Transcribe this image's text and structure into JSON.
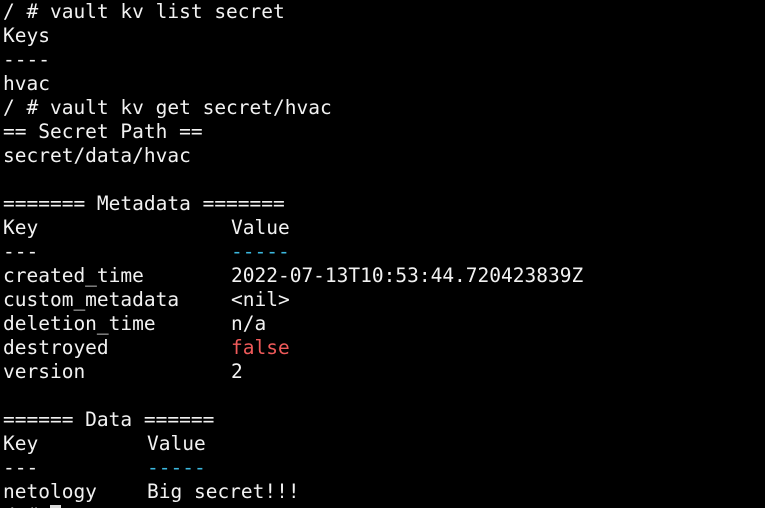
{
  "terminal": {
    "cmd_list": "/ # vault kv list secret",
    "list_header": "Keys",
    "list_rule": "----",
    "list_item": "hvac",
    "cmd_get": "/ # vault kv get secret/hvac",
    "path_banner": "== Secret Path ==",
    "path_value": "secret/data/hvac",
    "metadata_banner": "======= Metadata =======",
    "metadata_header": {
      "key": "Key",
      "value": "Value"
    },
    "metadata_rule": {
      "key": "---",
      "value": "-----"
    },
    "metadata_rows": [
      {
        "key": "created_time",
        "value": "2022-07-13T10:53:44.720423839Z"
      },
      {
        "key": "custom_metadata",
        "value": "<nil>"
      },
      {
        "key": "deletion_time",
        "value": "n/a"
      },
      {
        "key": "destroyed",
        "value": "false"
      },
      {
        "key": "version",
        "value": "2"
      }
    ],
    "data_banner": "====== Data ======",
    "data_header": {
      "key": "Key",
      "value": "Value"
    },
    "data_rule": {
      "key": "---",
      "value": "-----"
    },
    "data_rows": [
      {
        "key": "netology",
        "value": "Big secret!!!"
      }
    ],
    "prompt": "/ #"
  },
  "colors": {
    "background": "#000000",
    "text": "#f2f2f2",
    "separator": "#3bb8df",
    "false_value": "#ef5a5a"
  }
}
